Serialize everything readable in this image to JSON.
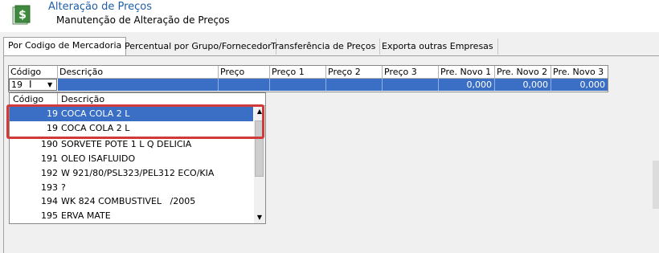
{
  "header": {
    "title": "Alteração de Preços",
    "subtitle": "Manutenção de Alteração de Preços",
    "icon": "spreadsheet-dollar-icon"
  },
  "tabs": [
    {
      "label": "Por Codigo de Mercadoria",
      "active": true
    },
    {
      "label": "Percentual por Grupo/Fornecedor",
      "active": false
    },
    {
      "label": "Transferência de Preços",
      "active": false
    },
    {
      "label": "Exporta outras Empresas",
      "active": false
    }
  ],
  "grid": {
    "columns": [
      "Código",
      "Descrição",
      "Preço Custo",
      "Preço 1",
      "Preço 2",
      "Preço 3",
      "Pre. Novo 1",
      "Pre. Novo 2",
      "Pre. Novo 3"
    ],
    "row": {
      "codigo": "19",
      "pre_novo_1": "0,000",
      "pre_novo_2": "0,000",
      "pre_novo_3": "0,000"
    }
  },
  "dropdown": {
    "columns": [
      "Código",
      "Descrição"
    ],
    "rows": [
      {
        "codigo": "19",
        "descricao": "COCA COLA 2 L"
      },
      {
        "codigo": "19",
        "descricao": "COCA COLA 2 L"
      },
      {
        "codigo": "190",
        "descricao": "SORVETE POTE 1 L Q DELICIA"
      },
      {
        "codigo": "191",
        "descricao": "OLEO ISAFLUIDO"
      },
      {
        "codigo": "192",
        "descricao": "W 921/80/PSL323/PEL312 ECO/KIA"
      },
      {
        "codigo": "193",
        "descricao": "?"
      },
      {
        "codigo": "194",
        "descricao": "WK 824 COMBUSTIVEL   /2005"
      },
      {
        "codigo": "195",
        "descricao": "ERVA MATE"
      }
    ]
  },
  "colors": {
    "selection": "#3b6fc6",
    "highlight": "#d13a3a",
    "title": "#1f5fa8"
  }
}
